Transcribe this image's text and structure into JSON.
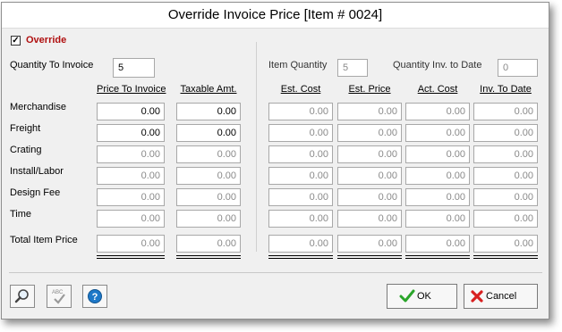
{
  "window": {
    "title": "Override Invoice Price [Item # 0024]"
  },
  "override": {
    "label": "Override",
    "checked": true
  },
  "quantity_to_invoice": {
    "label": "Quantity To Invoice",
    "value": "5"
  },
  "item_quantity": {
    "label": "Item Quantity",
    "value": "5"
  },
  "quantity_inv_to_date": {
    "label": "Quantity Inv. to Date",
    "value": "0"
  },
  "columns": {
    "price_to_invoice": "Price To Invoice",
    "taxable_amt": "Taxable Amt.",
    "est_cost": "Est. Cost",
    "est_price": "Est. Price",
    "act_cost": "Act. Cost",
    "inv_to_date": "Inv. To Date"
  },
  "rows": [
    {
      "label": "Merchandise",
      "price": "0.00",
      "taxable": "0.00",
      "est_cost": "0.00",
      "est_price": "0.00",
      "act_cost": "0.00",
      "inv_to_date": "0.00"
    },
    {
      "label": "Freight",
      "price": "0.00",
      "taxable": "0.00",
      "est_cost": "0.00",
      "est_price": "0.00",
      "act_cost": "0.00",
      "inv_to_date": "0.00"
    },
    {
      "label": "Crating",
      "price": "0.00",
      "taxable": "0.00",
      "est_cost": "0.00",
      "est_price": "0.00",
      "act_cost": "0.00",
      "inv_to_date": "0.00"
    },
    {
      "label": "Install/Labor",
      "price": "0.00",
      "taxable": "0.00",
      "est_cost": "0.00",
      "est_price": "0.00",
      "act_cost": "0.00",
      "inv_to_date": "0.00"
    },
    {
      "label": "Design Fee",
      "price": "0.00",
      "taxable": "0.00",
      "est_cost": "0.00",
      "est_price": "0.00",
      "act_cost": "0.00",
      "inv_to_date": "0.00"
    },
    {
      "label": "Time",
      "price": "0.00",
      "taxable": "0.00",
      "est_cost": "0.00",
      "est_price": "0.00",
      "act_cost": "0.00",
      "inv_to_date": "0.00"
    }
  ],
  "total": {
    "label": "Total Item Price",
    "price": "0.00",
    "taxable": "0.00",
    "est_cost": "0.00",
    "est_price": "0.00",
    "act_cost": "0.00",
    "inv_to_date": "0.00"
  },
  "buttons": {
    "ok": "OK",
    "cancel": "Cancel",
    "spellcheck_text": "ABC"
  },
  "icons": {
    "search": "magnifier-icon",
    "spellcheck": "spellcheck-icon",
    "help": "help-icon",
    "ok": "green-check-icon",
    "cancel": "red-x-icon"
  },
  "colors": {
    "override_text": "#b01010",
    "help_blue": "#1e78c8",
    "ok_green": "#2aa52a",
    "cancel_red": "#d82020"
  }
}
